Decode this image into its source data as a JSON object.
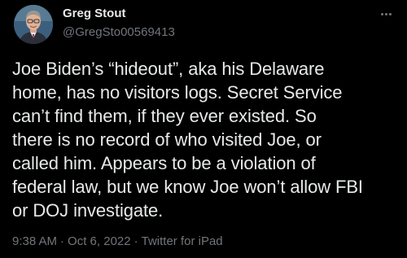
{
  "author": {
    "display_name": "Greg Stout",
    "handle": "@GregSto00569413",
    "avatar_icon": "profile-photo"
  },
  "tweet": {
    "text": "Joe Biden’s “hideout”, aka his Delaware\nhome, has no visitors logs. Secret Service\ncan’t find them, if they ever existed. So\nthere is no record of who visited Joe, or\ncalled him. Appears to be a violation of\nfederal law, but we know Joe won’t allow FBI\nor DOJ investigate."
  },
  "meta": {
    "time": "9:38 AM",
    "separator": "·",
    "date": "Oct 6, 2022",
    "source": "Twitter for iPad"
  },
  "menu": {
    "icon": "more-options-icon"
  },
  "colors": {
    "background": "#000000",
    "primary_text": "#e7e9ea",
    "secondary_text": "#71767b"
  }
}
